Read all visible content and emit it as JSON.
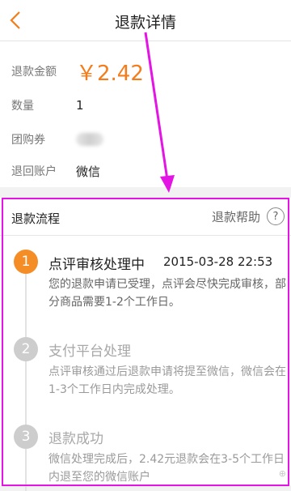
{
  "header": {
    "title": "退款详情",
    "back_icon": "chevron-left-icon"
  },
  "info": {
    "amount_label": "退款金额",
    "amount_value": "￥2.42",
    "quantity_label": "数量",
    "quantity_value": "1",
    "coupon_label": "团购券",
    "account_label": "退回账户",
    "account_value": "微信"
  },
  "flow": {
    "title": "退款流程",
    "help_label": "退款帮助",
    "help_icon": "question-circle-icon",
    "steps": [
      {
        "num": "1",
        "title": "点评审核处理中",
        "time": "2015-03-28 22:53",
        "desc": "您的退款申请已受理，点评会尽快完成审核，部分商品需要1-2个工作日。"
      },
      {
        "num": "2",
        "title": "支付平台处理",
        "desc": "点评审核通过后退款申请将提至微信，微信会在1-3个工作日内完成处理。"
      },
      {
        "num": "3",
        "title": "退款成功",
        "desc": "微信处理完成后，2.42元退款会在3-5个工作日内退至您的微信账户"
      }
    ]
  },
  "colors": {
    "accent": "#f57c1a",
    "step_active": "#f58d27",
    "step_idle": "#cdcdcd",
    "annotation": "#e414e4"
  }
}
